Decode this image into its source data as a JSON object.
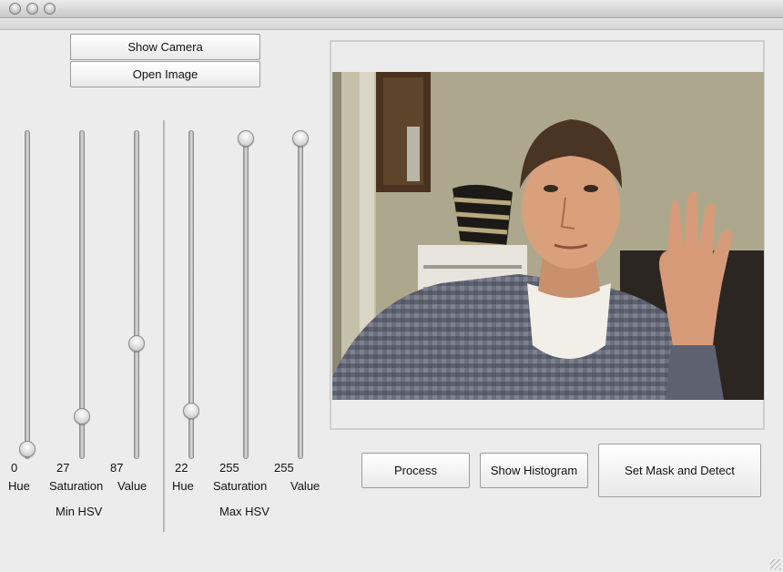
{
  "controls": {
    "show_camera": "Show Camera",
    "open_image": "Open Image"
  },
  "min_hsv": {
    "group_label": "Min HSV",
    "hue": {
      "label": "Hue",
      "value": "0",
      "fraction": 0
    },
    "saturation": {
      "label": "Saturation",
      "value": "27",
      "fraction": 0.106
    },
    "value": {
      "label": "Value",
      "value": "87",
      "fraction": 0.341
    }
  },
  "max_hsv": {
    "group_label": "Max HSV",
    "hue": {
      "label": "Hue",
      "value": "22",
      "fraction": 0.124
    },
    "saturation": {
      "label": "Saturation",
      "value": "255",
      "fraction": 1
    },
    "value": {
      "label": "Value",
      "value": "255",
      "fraction": 1
    }
  },
  "actions": {
    "process": "Process",
    "show_histogram": "Show Histogram",
    "set_mask_and_detect": "Set Mask and Detect"
  },
  "colors": {
    "wall": "#aea98e",
    "shirt": "#5d6170",
    "skin": "#d9a07c",
    "hair": "#4a3424"
  }
}
